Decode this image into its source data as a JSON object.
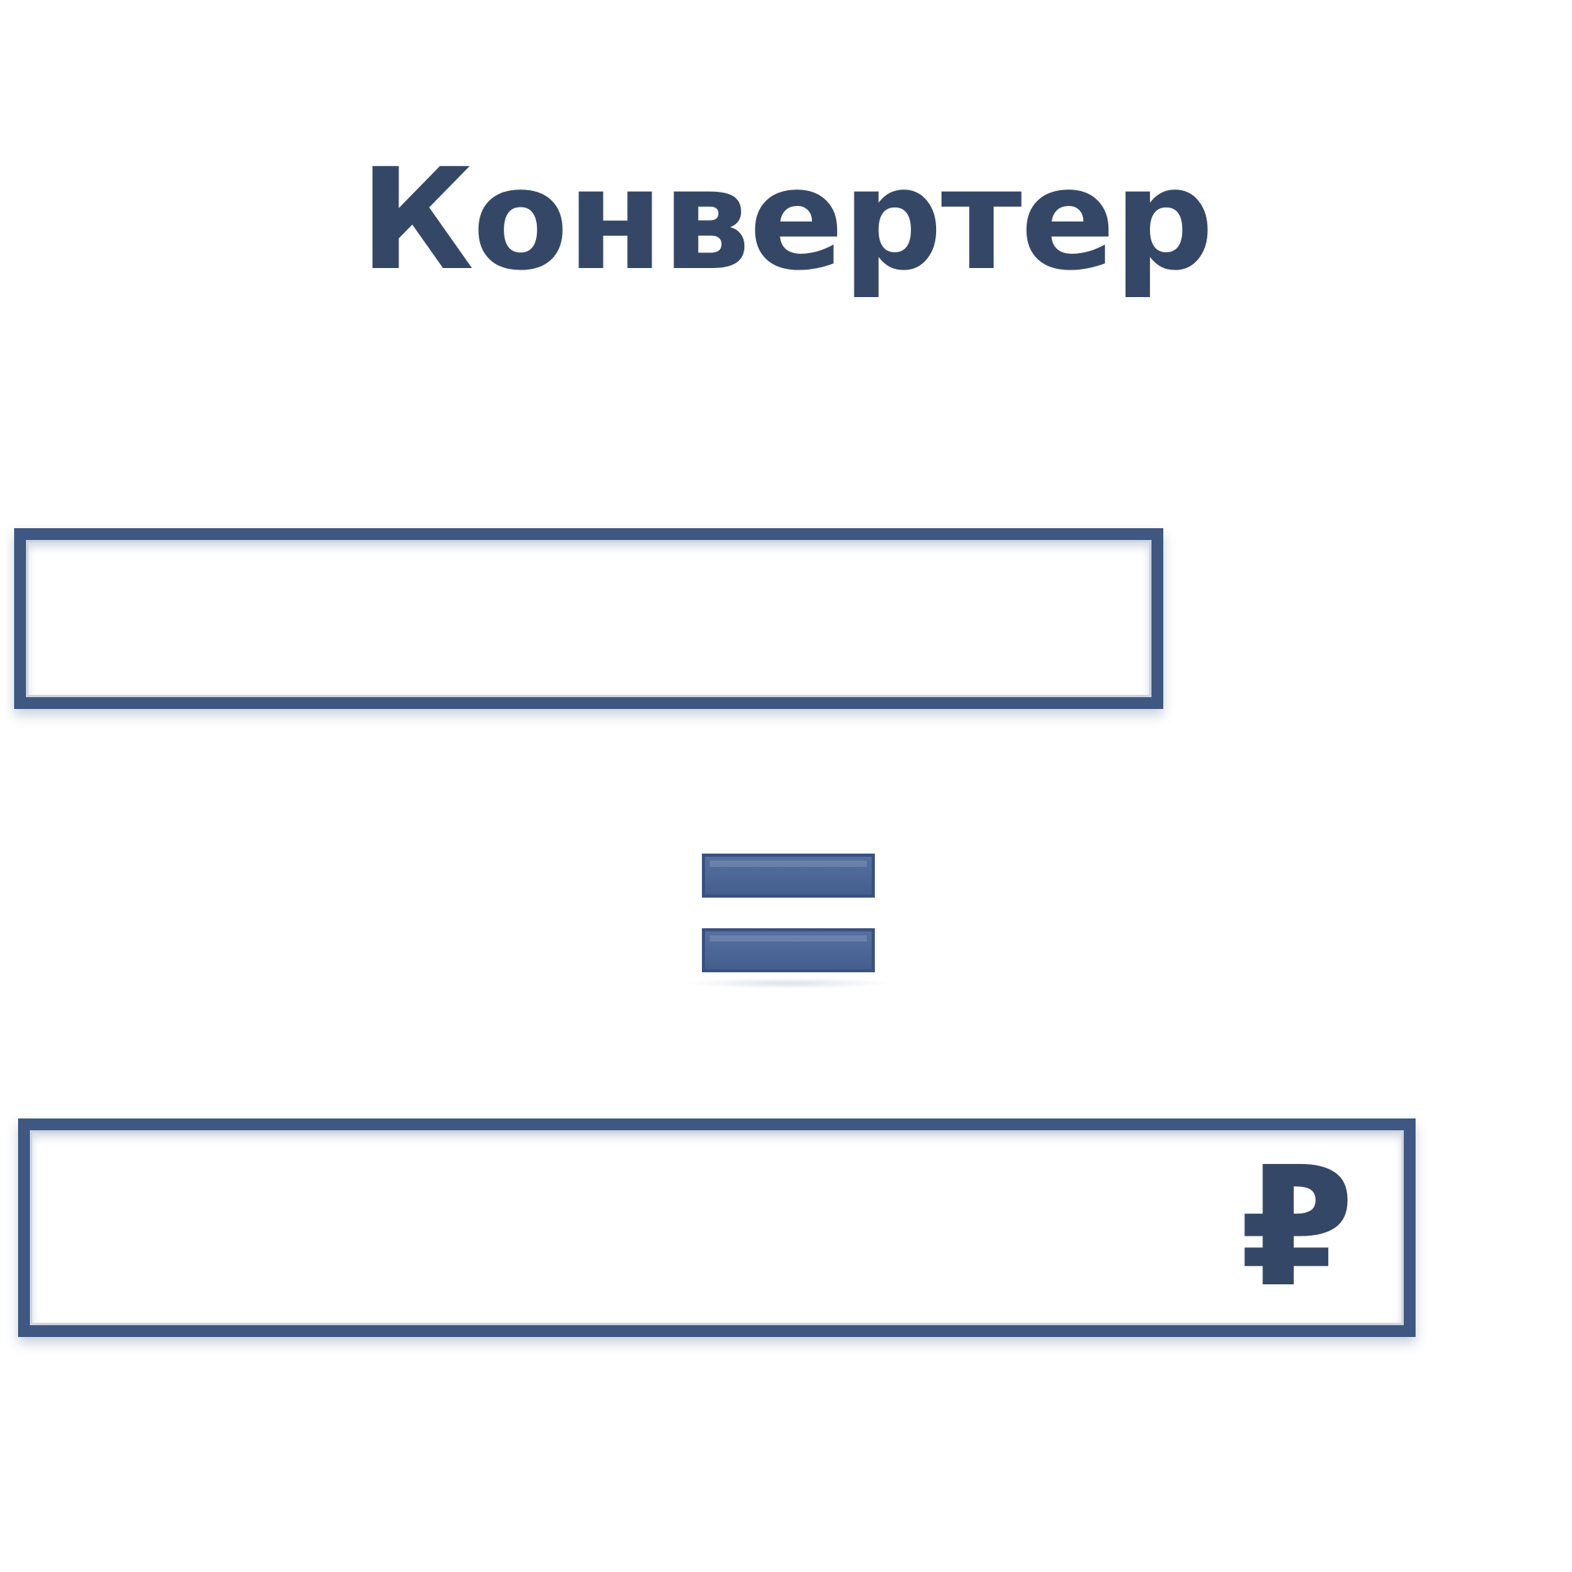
{
  "app": {
    "title": "Конвертер"
  },
  "amount_field": {
    "value": "",
    "placeholder": ""
  },
  "equals_sign": {
    "icon": "equals-icon"
  },
  "result_field": {
    "value": "",
    "placeholder": "",
    "currency_symbol": "₽"
  },
  "colors": {
    "text": "#354767",
    "border": "#3f5882",
    "background": "#ffffff"
  }
}
